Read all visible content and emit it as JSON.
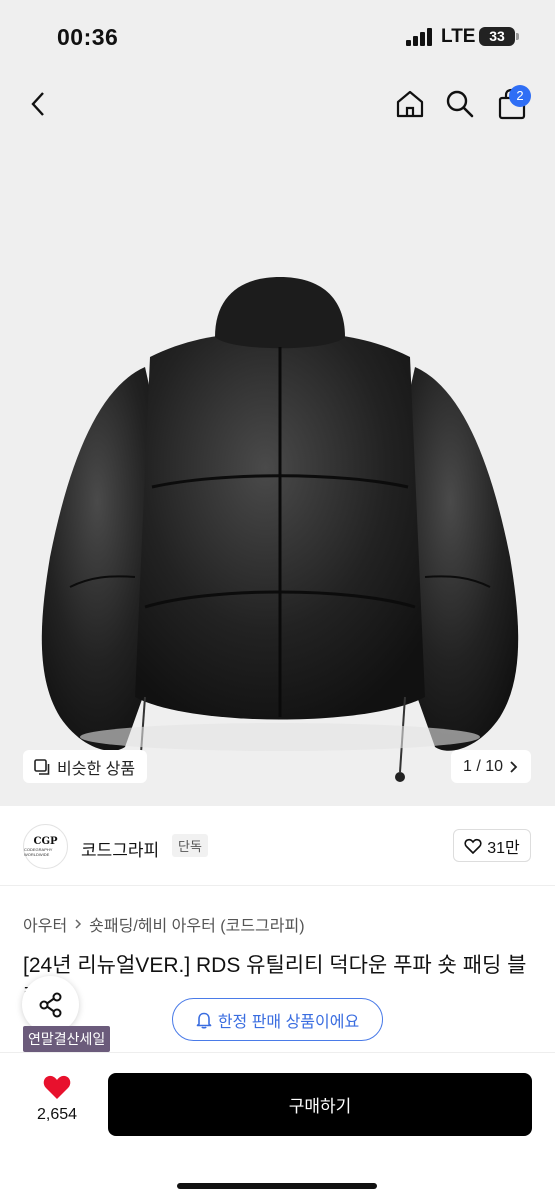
{
  "status_bar": {
    "time": "00:36",
    "network": "LTE",
    "battery": "33"
  },
  "nav": {
    "cart_count": "2",
    "icons": [
      "back-arrow-icon",
      "home-icon",
      "search-icon",
      "bag-icon"
    ]
  },
  "gallery": {
    "similar_label": "비슷한 상품",
    "page_indicator": "1 / 10"
  },
  "brand": {
    "logo_text": "CGP",
    "logo_subtext": "CODEGRAPHY WORLDWIDE",
    "name": "코드그라피",
    "tag": "단독",
    "like_count": "31만"
  },
  "product": {
    "breadcrumb": [
      "아우터",
      "숏패딩/헤비 아우터 (코드그라피)"
    ],
    "title": "[24년 리뉴얼VER.] RDS 유틸리티 덕다운 푸파 숏 패딩 블랙",
    "limited_label": "한정 판매 상품이에요",
    "sale_tag": "연말결산세일"
  },
  "bottom": {
    "wish_count": "2,654",
    "buy_label": "구매하기"
  },
  "colors": {
    "accent_blue": "#2f6ef5",
    "heart_red": "#e8112d",
    "sale_purple": "#6b5b7b",
    "buy_black": "#000000"
  }
}
